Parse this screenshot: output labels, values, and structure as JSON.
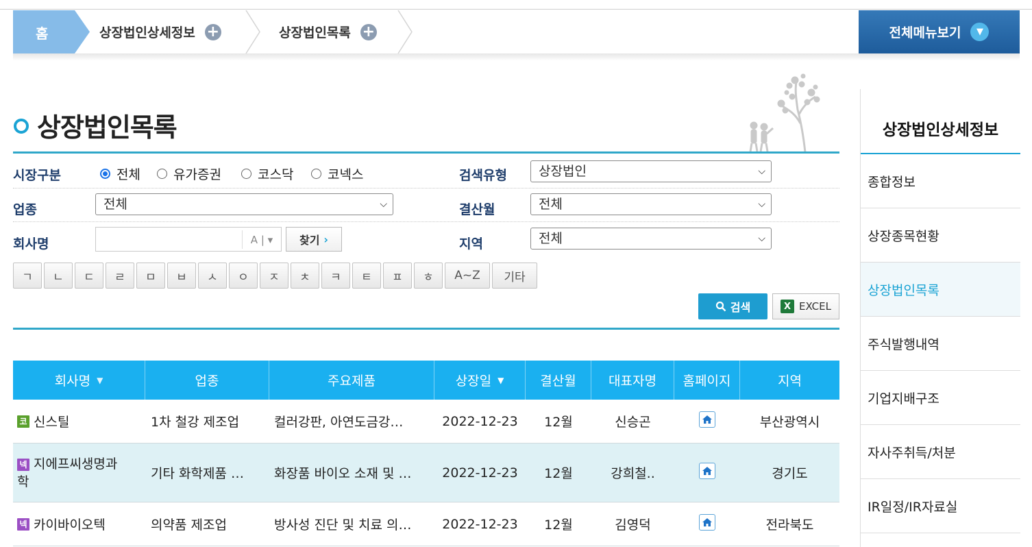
{
  "breadcrumb": {
    "home": "홈",
    "items": [
      {
        "label": "상장법인상세정보"
      },
      {
        "label": "상장법인목록"
      }
    ],
    "all_menu": "전체메뉴보기"
  },
  "page_title": "상장법인목록",
  "form": {
    "market_label": "시장구분",
    "market_options": [
      "전체",
      "유가증권",
      "코스닥",
      "코넥스"
    ],
    "market_selected": "전체",
    "search_type_label": "검색유형",
    "search_type_value": "상장법인",
    "industry_label": "업종",
    "industry_value": "전체",
    "fiscal_label": "결산월",
    "fiscal_value": "전체",
    "company_label": "회사명",
    "company_value": "",
    "find_button": "찾기",
    "region_label": "지역",
    "region_value": "전체",
    "initials": [
      "ㄱ",
      "ㄴ",
      "ㄷ",
      "ㄹ",
      "ㅁ",
      "ㅂ",
      "ㅅ",
      "ㅇ",
      "ㅈ",
      "ㅊ",
      "ㅋ",
      "ㅌ",
      "ㅍ",
      "ㅎ",
      "A~Z",
      "기타"
    ],
    "search_button": "검색",
    "excel_button": "EXCEL"
  },
  "table": {
    "headers": [
      "회사명",
      "업종",
      "주요제품",
      "상장일",
      "결산월",
      "대표자명",
      "홈페이지",
      "지역"
    ],
    "rows": [
      {
        "badge": "코",
        "badge_color": "#5aa02c",
        "company": "신스틸",
        "industry": "1차 철강 제조업",
        "product": "컬러강판, 아연도금강…",
        "date": "2022-12-23",
        "fiscal": "12월",
        "ceo": "신승곤",
        "region": "부산광역시"
      },
      {
        "badge": "넥",
        "badge_color": "#9b4fc4",
        "company": "지에프씨생명과",
        "company2": "학",
        "industry": "기타 화학제품 …",
        "product": "화장품 바이오 소재 및 …",
        "date": "2022-12-23",
        "fiscal": "12월",
        "ceo": "강희철..",
        "region": "경기도"
      },
      {
        "badge": "넥",
        "badge_color": "#9b4fc4",
        "company": "카이바이오텍",
        "industry": "의약품 제조업",
        "product": "방사성 진단 및 치료 의…",
        "date": "2022-12-23",
        "fiscal": "12월",
        "ceo": "김영덕",
        "region": "전라북도"
      }
    ]
  },
  "sidebar": {
    "title": "상장법인상세정보",
    "items": [
      "종합정보",
      "상장종목현황",
      "상장법인목록",
      "주식발행내역",
      "기업지배구조",
      "자사주취득/처분",
      "IR일정/IR자료실"
    ],
    "active": "상장법인목록"
  }
}
